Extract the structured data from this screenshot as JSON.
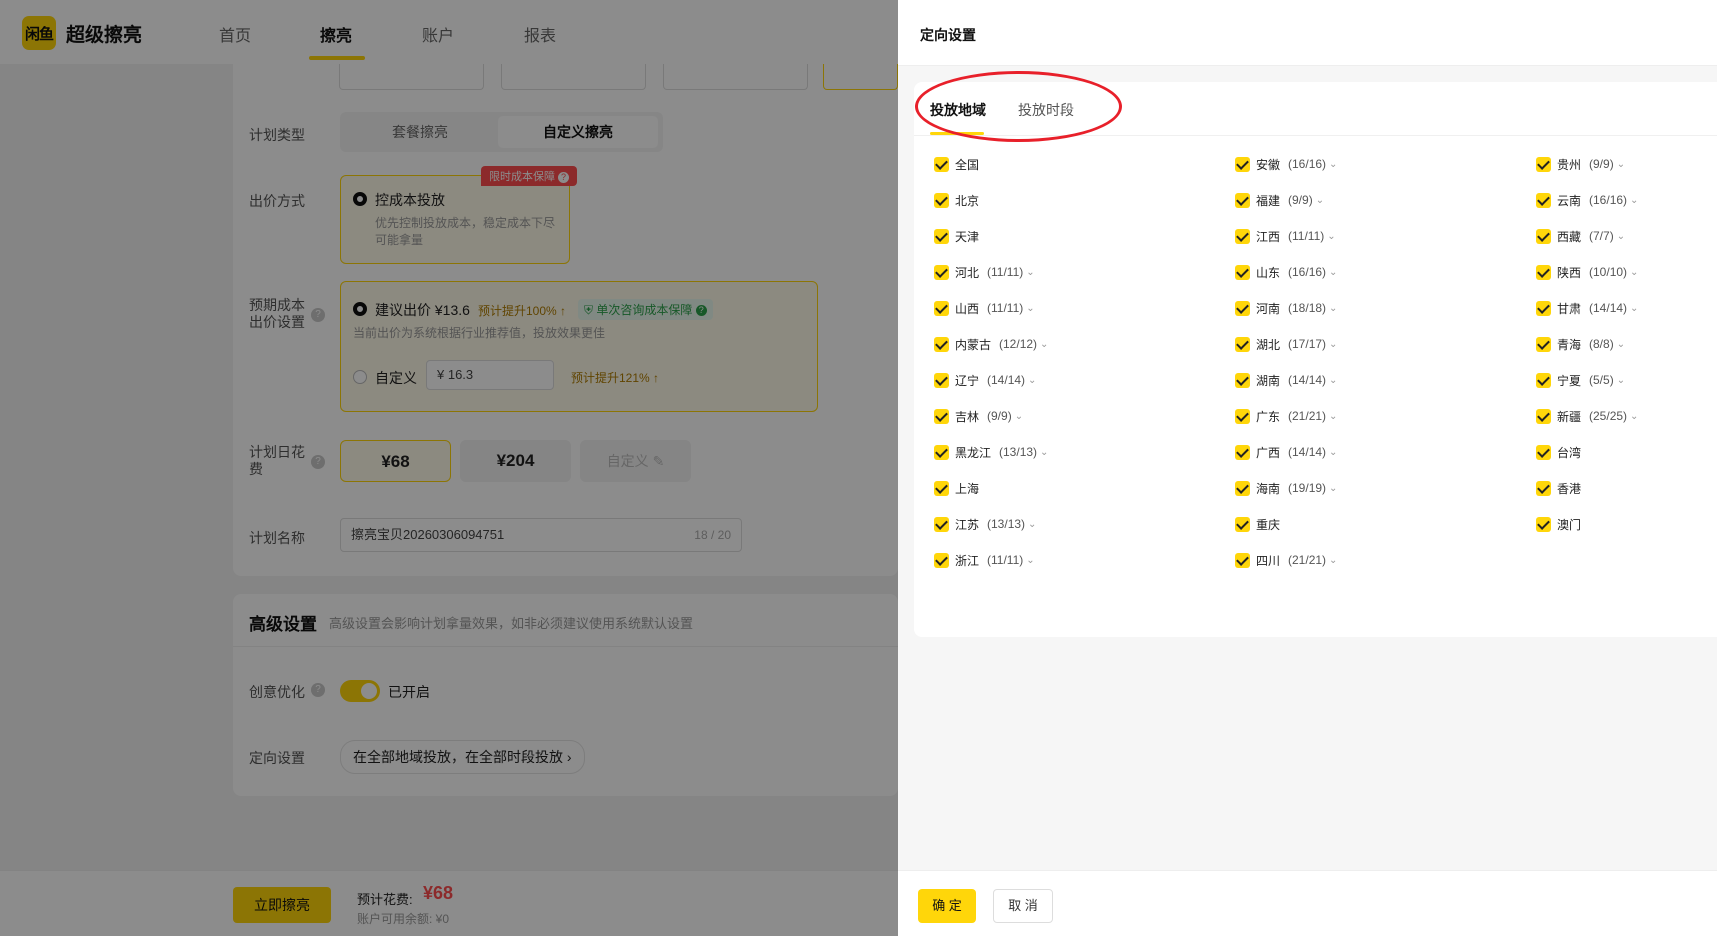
{
  "app": {
    "logo_text": "闲鱼",
    "brand": "超级擦亮"
  },
  "nav": {
    "tabs": [
      "首页",
      "擦亮",
      "账户",
      "报表"
    ],
    "active": "擦亮"
  },
  "form": {
    "plan_type": {
      "label": "计划类型",
      "options": [
        "套餐擦亮",
        "自定义擦亮"
      ],
      "selected": "自定义擦亮"
    },
    "bid_method": {
      "label": "出价方式",
      "badge": "限时成本保障",
      "option_title": "控成本投放",
      "option_desc_1": "优先控制投放成本，稳定成本下尽",
      "option_desc_2": "可能拿量"
    },
    "expected_cost": {
      "label_1": "预期成本",
      "label_2": "出价设置",
      "suggest_label": "建议出价 ¥13.6",
      "suggest_tip": "预计提升100%",
      "guarantee_tip": "单次咨询成本保障",
      "suggest_desc": "当前出价为系统根据行业推荐值，投放效果更佳",
      "custom_label": "自定义",
      "custom_value": "¥  16.3",
      "custom_tip": "预计提升121%"
    },
    "daily_budget": {
      "label_1": "计划日花",
      "label_2": "费",
      "options": [
        "¥68",
        "¥204"
      ],
      "custom": "自定义"
    },
    "plan_name": {
      "label": "计划名称",
      "value": "擦亮宝贝20260306094751",
      "count": "18 / 20"
    }
  },
  "advanced": {
    "title": "高级设置",
    "desc": "高级设置会影响计划拿量效果，如非必须建议使用系统默认设置",
    "creative_label": "创意优化",
    "creative_status": "已开启",
    "targeting_label": "定向设置",
    "targeting_value": "在全部地域投放，在全部时段投放 ›"
  },
  "bottom": {
    "submit": "立即擦亮",
    "cost_label": "预计花费:",
    "cost_value": "¥68",
    "balance": "账户可用余额: ¥0"
  },
  "drawer": {
    "title": "定向设置",
    "tabs": [
      "投放地域",
      "投放时段"
    ],
    "active_tab": "投放地域",
    "regions": [
      {
        "name": "全国",
        "count": ""
      },
      {
        "name": "北京",
        "count": ""
      },
      {
        "name": "天津",
        "count": ""
      },
      {
        "name": "河北",
        "count": "(11/11)"
      },
      {
        "name": "山西",
        "count": "(11/11)"
      },
      {
        "name": "内蒙古",
        "count": "(12/12)"
      },
      {
        "name": "辽宁",
        "count": "(14/14)"
      },
      {
        "name": "吉林",
        "count": "(9/9)"
      },
      {
        "name": "黑龙江",
        "count": "(13/13)"
      },
      {
        "name": "上海",
        "count": ""
      },
      {
        "name": "江苏",
        "count": "(13/13)"
      },
      {
        "name": "浙江",
        "count": "(11/11)"
      },
      {
        "name": "安徽",
        "count": "(16/16)"
      },
      {
        "name": "福建",
        "count": "(9/9)"
      },
      {
        "name": "江西",
        "count": "(11/11)"
      },
      {
        "name": "山东",
        "count": "(16/16)"
      },
      {
        "name": "河南",
        "count": "(18/18)"
      },
      {
        "name": "湖北",
        "count": "(17/17)"
      },
      {
        "name": "湖南",
        "count": "(14/14)"
      },
      {
        "name": "广东",
        "count": "(21/21)"
      },
      {
        "name": "广西",
        "count": "(14/14)"
      },
      {
        "name": "海南",
        "count": "(19/19)"
      },
      {
        "name": "重庆",
        "count": ""
      },
      {
        "name": "四川",
        "count": "(21/21)"
      },
      {
        "name": "贵州",
        "count": "(9/9)"
      },
      {
        "name": "云南",
        "count": "(16/16)"
      },
      {
        "name": "西藏",
        "count": "(7/7)"
      },
      {
        "name": "陕西",
        "count": "(10/10)"
      },
      {
        "name": "甘肃",
        "count": "(14/14)"
      },
      {
        "name": "青海",
        "count": "(8/8)"
      },
      {
        "name": "宁夏",
        "count": "(5/5)"
      },
      {
        "name": "新疆",
        "count": "(25/25)"
      },
      {
        "name": "台湾",
        "count": ""
      },
      {
        "name": "香港",
        "count": ""
      },
      {
        "name": "澳门",
        "count": ""
      }
    ],
    "confirm": "确 定",
    "cancel": "取 消"
  },
  "colors": {
    "accent": "#ffd60a",
    "danger": "#ff4d4f",
    "annotation": "#e8202a"
  }
}
